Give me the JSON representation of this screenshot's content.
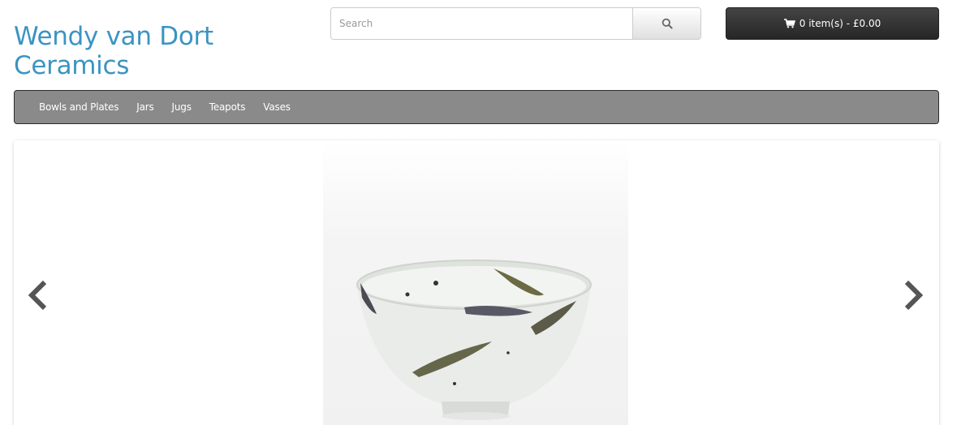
{
  "header": {
    "logo_line1": "Wendy van Dort",
    "logo_line2": "Ceramics",
    "logo_color": "#3b94c2"
  },
  "search": {
    "placeholder": "Search",
    "value": "",
    "button_icon": "search-icon"
  },
  "cart": {
    "icon": "shopping-cart-icon",
    "label": "0 item(s) - £0.00"
  },
  "menu": {
    "items": [
      {
        "label": "Bowls and Plates"
      },
      {
        "label": "Jars"
      },
      {
        "label": "Jugs"
      },
      {
        "label": "Teapots"
      },
      {
        "label": "Vases"
      }
    ],
    "background": "#8a8a8a"
  },
  "slideshow": {
    "prev_icon": "chevron-left-icon",
    "next_icon": "chevron-right-icon",
    "image_subject": "ceramic bowl"
  }
}
